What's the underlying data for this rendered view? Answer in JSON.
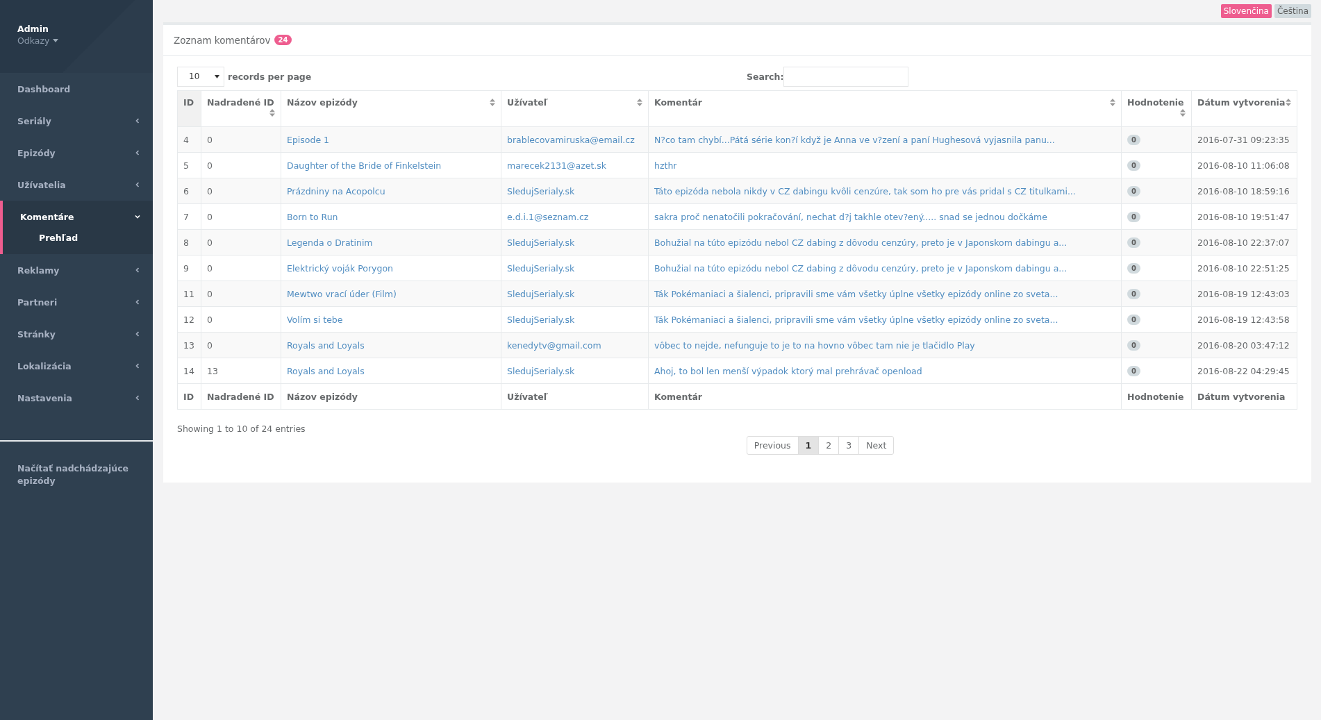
{
  "sidebar": {
    "user_name": "Admin",
    "user_menu": "Odkazy",
    "items": [
      {
        "label": "Dashboard",
        "kind": "link",
        "selected": false
      },
      {
        "label": "Seriály",
        "kind": "group",
        "expanded": false,
        "selected": false
      },
      {
        "label": "Epizódy",
        "kind": "group",
        "expanded": false,
        "selected": false
      },
      {
        "label": "Užívatelia",
        "kind": "group",
        "expanded": false,
        "selected": false
      },
      {
        "label": "Komentáre",
        "kind": "group",
        "expanded": true,
        "selected": true,
        "children": [
          {
            "label": "Prehľad",
            "selected": true
          }
        ]
      },
      {
        "label": "Reklamy",
        "kind": "group",
        "expanded": false,
        "selected": false
      },
      {
        "label": "Partneri",
        "kind": "group",
        "expanded": false,
        "selected": false
      },
      {
        "label": "Stránky",
        "kind": "group",
        "expanded": false,
        "selected": false
      },
      {
        "label": "Lokalizácia",
        "kind": "group",
        "expanded": false,
        "selected": false
      },
      {
        "label": "Nastavenia",
        "kind": "group",
        "expanded": false,
        "selected": false
      }
    ],
    "bottom_link": "Načítať nadchádzajúce epizódy"
  },
  "languages": [
    {
      "label": "Slovenčina",
      "selected": true
    },
    {
      "label": "Čeština",
      "selected": false
    }
  ],
  "panel": {
    "title": "Zoznam komentárov",
    "count": "24",
    "length_select": {
      "value": "10",
      "label": "records per page"
    },
    "search": {
      "label": "Search:"
    },
    "table": {
      "columns": [
        {
          "label": "ID",
          "sortable": false,
          "sorted": true
        },
        {
          "label": "Nadradené ID",
          "sortable": true,
          "sorted": false
        },
        {
          "label": "Názov epizódy",
          "sortable": true,
          "sorted": false
        },
        {
          "label": "Užívateľ",
          "sortable": true,
          "sorted": false
        },
        {
          "label": "Komentár",
          "sortable": true,
          "sorted": false
        },
        {
          "label": "Hodnotenie",
          "sortable": true,
          "sorted": false
        },
        {
          "label": "Dátum vytvorenia",
          "sortable": true,
          "sorted": false
        }
      ],
      "rows": [
        {
          "id": "4",
          "parent_id": "0",
          "episode": "Episode 1",
          "user": "brablecovamiruska@email.cz",
          "comment": "N?co tam chybí...Pátá série kon?í když je Anna ve v?zení a paní Hughesová vyjasnila panu...",
          "rating": "0",
          "created": "2016-07-31 09:23:35"
        },
        {
          "id": "5",
          "parent_id": "0",
          "episode": "Daughter of the Bride of Finkelstein",
          "user": "marecek2131@azet.sk",
          "comment": "hzthr",
          "rating": "0",
          "created": "2016-08-10 11:06:08"
        },
        {
          "id": "6",
          "parent_id": "0",
          "episode": "Prázdniny na Acopolcu",
          "user": "SledujSerialy.sk",
          "comment": "Táto epizóda nebola nikdy v CZ dabingu kvôli cenzúre, tak som ho pre vás pridal s CZ titulkami...",
          "rating": "0",
          "created": "2016-08-10 18:59:16"
        },
        {
          "id": "7",
          "parent_id": "0",
          "episode": "Born to Run",
          "user": "e.d.i.1@seznam.cz",
          "comment": "sakra proč nenatočili pokračování, nechat d?j takhle otev?ený..... snad se jednou dočkáme",
          "rating": "0",
          "created": "2016-08-10 19:51:47"
        },
        {
          "id": "8",
          "parent_id": "0",
          "episode": "Legenda o Dratinim",
          "user": "SledujSerialy.sk",
          "comment": "Bohužial na túto epizódu nebol CZ dabing z dôvodu cenzúry, preto je v Japonskom dabingu a...",
          "rating": "0",
          "created": "2016-08-10 22:37:07"
        },
        {
          "id": "9",
          "parent_id": "0",
          "episode": "Elektrický voják Porygon",
          "user": "SledujSerialy.sk",
          "comment": "Bohužial na túto epizódu nebol CZ dabing z dôvodu cenzúry, preto je v Japonskom dabingu a...",
          "rating": "0",
          "created": "2016-08-10 22:51:25"
        },
        {
          "id": "11",
          "parent_id": "0",
          "episode": "Mewtwo vrací úder (Film)",
          "user": "SledujSerialy.sk",
          "comment": "Ták Pokémaniaci a šialenci, pripravili sme vám všetky úplne všetky epizódy online zo sveta...",
          "rating": "0",
          "created": "2016-08-19 12:43:03"
        },
        {
          "id": "12",
          "parent_id": "0",
          "episode": "Volím si tebe",
          "user": "SledujSerialy.sk",
          "comment": "Ták Pokémaniaci a šialenci, pripravili sme vám všetky úplne všetky epizódy online zo sveta...",
          "rating": "0",
          "created": "2016-08-19 12:43:58"
        },
        {
          "id": "13",
          "parent_id": "0",
          "episode": "Royals and Loyals",
          "user": "kenedytv@gmail.com",
          "comment": "vôbec to nejde, nefunguje to je to na hovno vôbec tam nie je tlačidlo Play",
          "rating": "0",
          "created": "2016-08-20 03:47:12"
        },
        {
          "id": "14",
          "parent_id": "13",
          "episode": "Royals and Loyals",
          "user": "SledujSerialy.sk",
          "comment": "Ahoj, to bol len menší výpadok ktorý mal prehrávač openload",
          "rating": "0",
          "created": "2016-08-22 04:29:45"
        }
      ],
      "footer": [
        "ID",
        "Nadradené ID",
        "Názov epizódy",
        "Užívateľ",
        "Komentár",
        "Hodnotenie",
        "Dátum vytvorenia"
      ]
    },
    "info": "Showing 1 to 10 of 24 entries",
    "pagination": {
      "previous": "Previous",
      "pages": [
        {
          "label": "1",
          "selected": true
        },
        {
          "label": "2",
          "selected": false
        },
        {
          "label": "3",
          "selected": false
        }
      ],
      "next": "Next"
    }
  }
}
